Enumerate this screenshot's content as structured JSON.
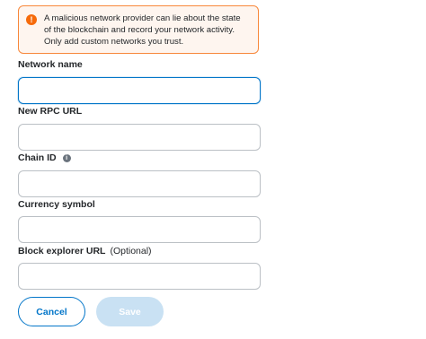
{
  "warning": {
    "icon": "exclamation-circle-icon",
    "text": "A malicious network provider can lie about the state of the blockchain and record your network activity. Only add custom networks you trust."
  },
  "fields": {
    "network_name": {
      "label": "Network name",
      "value": ""
    },
    "rpc_url": {
      "label": "New RPC URL",
      "value": ""
    },
    "chain_id": {
      "label": "Chain ID",
      "value": "",
      "info_icon": "info-icon"
    },
    "currency_symbol": {
      "label": "Currency symbol",
      "value": ""
    },
    "block_explorer": {
      "label": "Block explorer URL",
      "optional": "(Optional)",
      "value": ""
    }
  },
  "buttons": {
    "cancel": "Cancel",
    "save": "Save"
  },
  "colors": {
    "accent": "#0376c9",
    "warning_border": "#f8883b",
    "warning_bg": "#fef5ef",
    "save_disabled_bg": "#c9e1f3"
  }
}
